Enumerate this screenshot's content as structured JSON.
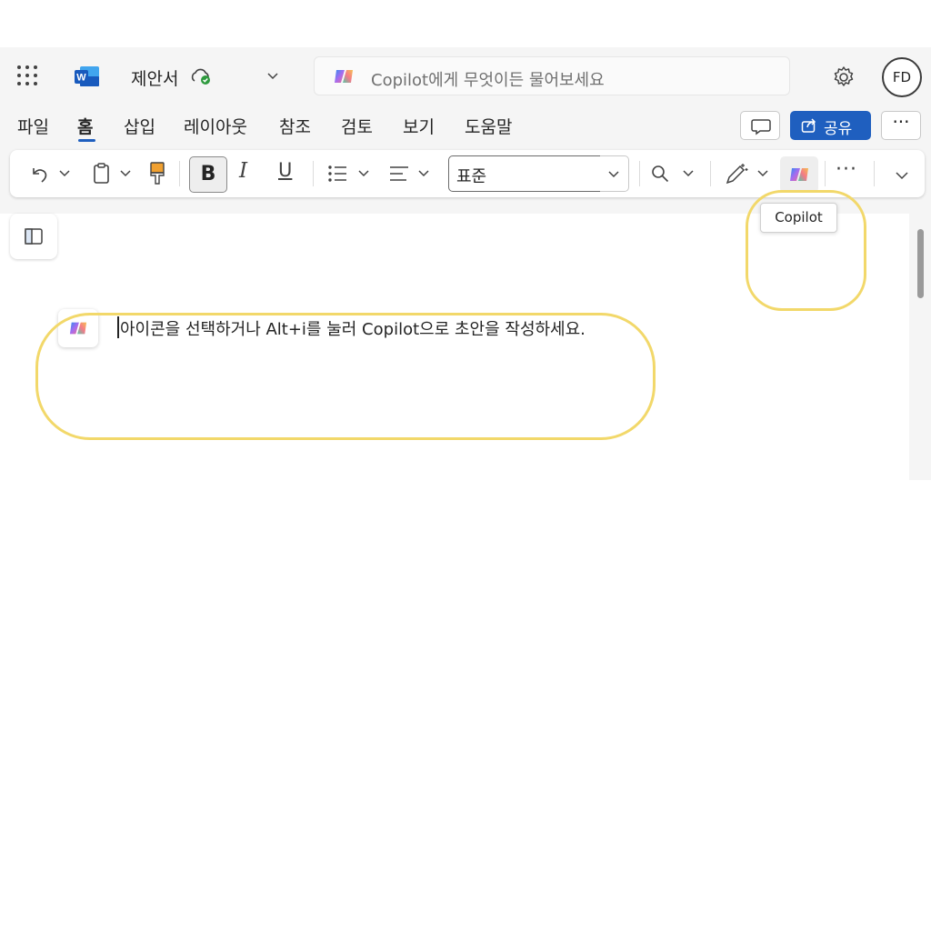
{
  "titlebar": {
    "doc_title": "제안서",
    "search_placeholder": "Copilot에게 무엇이든 물어보세요",
    "avatar_initials": "FD"
  },
  "tabs": [
    {
      "label": "파일"
    },
    {
      "label": "홈",
      "active": true
    },
    {
      "label": "삽입"
    },
    {
      "label": "레이아웃"
    },
    {
      "label": "참조"
    },
    {
      "label": "검토"
    },
    {
      "label": "보기"
    },
    {
      "label": "도움말"
    }
  ],
  "actions": {
    "share_label": "공유",
    "more_label": "···"
  },
  "ribbon": {
    "bold_label": "B",
    "italic_label": "I",
    "underline_label": "U",
    "style_value": "표준",
    "more_label": "···"
  },
  "tooltip": {
    "label": "Copilot"
  },
  "document": {
    "prompt_text": "아이콘을 선택하거나 Alt+i를 눌러 Copilot으로 초안을 작성하세요."
  },
  "colors": {
    "accent": "#1f5fbf",
    "highlight": "#f2d86a",
    "word_blue": "#185abd"
  },
  "icons": [
    "app-launcher-icon",
    "word-logo-icon",
    "cloud-saved-icon",
    "chevron-down-icon",
    "copilot-icon",
    "settings-icon",
    "comment-icon",
    "share-icon",
    "undo-icon",
    "clipboard-icon",
    "format-painter-icon",
    "bullets-icon",
    "align-icon",
    "search-icon",
    "editor-icon",
    "nav-pane-icon"
  ]
}
